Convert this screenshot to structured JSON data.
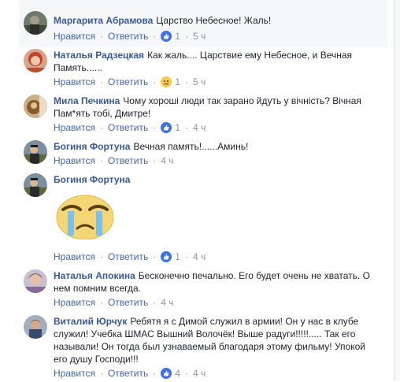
{
  "comments": [
    {
      "author": "Маргарита Абрамова",
      "text": "Царство Небесное! Жаль!",
      "like": "Нравится",
      "reply": "Ответить",
      "reaction": "like",
      "reactions_count": "1",
      "time": "5 ч"
    },
    {
      "author": "Наталья Радзецкая",
      "text": "Как жаль.... Царствие ему Небесное, и Вечная Память......",
      "like": "Нравится",
      "reply": "Ответить",
      "reaction": "sad",
      "reactions_count": "1",
      "time": "5 ч"
    },
    {
      "author": "Мила Печкина",
      "text": "Чому хороші люди так зарано йдуть у вічність? Вічная Пам*ять тобі, Дмитре!",
      "like": "Нравится",
      "reply": "Ответить",
      "reaction": "like",
      "reactions_count": "1",
      "time": "4 ч"
    },
    {
      "author": "Богиня Фортуна",
      "text": "Вечная память!......Аминь!",
      "like": "Нравится",
      "reply": "Ответить",
      "time": "4 ч"
    },
    {
      "author": "Богиня Фортуна",
      "text": "",
      "like": "Нравится",
      "reply": "Ответить",
      "reaction": "like",
      "reactions_count": "1",
      "time": "4 ч"
    },
    {
      "author": "Наталья Апокина",
      "text": "Бесконечно печально. Его будет очень не хватать. О нем помним всегда.",
      "like": "Нравится",
      "reply": "Ответить",
      "time": "4 ч"
    },
    {
      "author": "Виталий Юрчук",
      "text": "Ребятя я с Димой служил в армии! Он у нас в клубе служил! Учебка ШМАС Вышний Волочёк! Выше радуги!!!!!..... Так его называли! Он тогда был узнаваемый благодаря этому фильму! Упокой его душу Господи!!!",
      "like": "Нравится",
      "reply": "Ответить",
      "reaction": "like",
      "reactions_count": "4",
      "time": "4 ч"
    }
  ],
  "icons": {
    "like_reaction": "thumbs-up-icon",
    "sad_reaction": "sad-face-icon",
    "sticker": "crying-face-sticker"
  },
  "colors": {
    "author_link": "#385898",
    "action_link": "#4267b2",
    "meta_gray": "#90949c",
    "comment_bg": "#f6f7f9",
    "like_blue": "#3b72e7",
    "sad_yellow": "#f7c84b"
  }
}
